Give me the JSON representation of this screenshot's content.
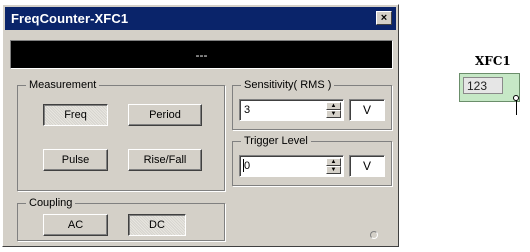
{
  "window": {
    "title": "FreqCounter-XFC1",
    "close_label": "×",
    "display_value": "---"
  },
  "measurement": {
    "legend": "Measurement",
    "buttons": [
      {
        "label": "Freq",
        "selected": true
      },
      {
        "label": "Period",
        "selected": false
      },
      {
        "label": "Pulse",
        "selected": false
      },
      {
        "label": "Rise/Fall",
        "selected": false
      }
    ]
  },
  "coupling": {
    "legend": "Coupling",
    "buttons": [
      {
        "label": "AC",
        "selected": false
      },
      {
        "label": "DC",
        "selected": true
      }
    ]
  },
  "sensitivity": {
    "legend": "Sensitivity( RMS )",
    "value": "3",
    "unit": "V"
  },
  "trigger": {
    "legend": "Trigger Level",
    "value": "0",
    "unit": "V"
  },
  "component": {
    "label": "XFC1",
    "screen_text": "123",
    "body_color": "#c6e8c6"
  },
  "colors": {
    "titlebar": "#0a246a",
    "dialog": "#d4d0c8",
    "display": "#000000"
  },
  "icons": {
    "close": "close-icon",
    "spin_up": "spin-up-arrow-icon",
    "spin_down": "spin-down-arrow-icon",
    "status": "status-indicator-icon"
  }
}
